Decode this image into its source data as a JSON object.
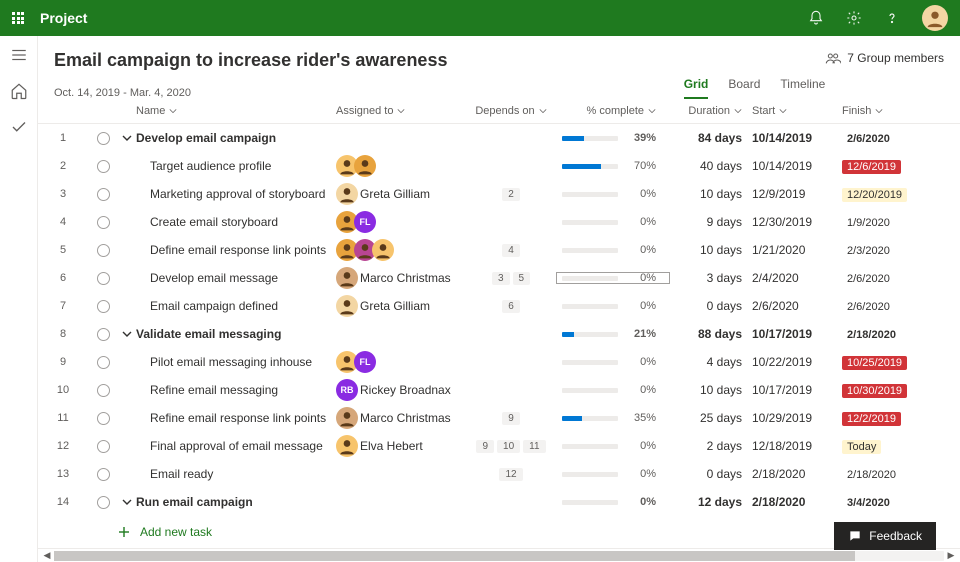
{
  "header": {
    "app_name": "Project",
    "waffle": "app-launcher",
    "bell": "notifications-icon",
    "gear": "settings-icon",
    "help": "help-icon"
  },
  "rail": {
    "hamburger": "menu-icon",
    "home": "home-icon",
    "check": "check-icon"
  },
  "project": {
    "title": "Email campaign to increase rider's awareness",
    "dates": "Oct. 14, 2019 - Mar. 4, 2020",
    "group_members": "7 Group members"
  },
  "tabs": {
    "grid": "Grid",
    "board": "Board",
    "timeline": "Timeline",
    "active": "grid"
  },
  "columns": {
    "name": "Name",
    "assigned": "Assigned to",
    "depends": "Depends on",
    "pct": "% complete",
    "duration": "Duration",
    "start": "Start",
    "finish": "Finish"
  },
  "tasks": [
    {
      "n": 1,
      "summary": true,
      "name": "Develop email campaign",
      "assigned": [],
      "assigned_name": "",
      "deps": [],
      "pct": 39,
      "dur": "84 days",
      "start": "10/14/2019",
      "finish": "2/6/2020",
      "finish_style": ""
    },
    {
      "n": 2,
      "summary": false,
      "name": "Target audience profile",
      "assigned": [
        {
          "bg": "#f7c46c",
          "person": true
        },
        {
          "bg": "#e8a33d",
          "person": true
        }
      ],
      "assigned_name": "",
      "deps": [],
      "pct": 70,
      "dur": "40 days",
      "start": "10/14/2019",
      "finish": "12/6/2019",
      "finish_style": "red"
    },
    {
      "n": 3,
      "summary": false,
      "name": "Marketing approval of storyboard",
      "assigned": [
        {
          "bg": "#f3d6a3",
          "person": true
        }
      ],
      "assigned_name": "Greta Gilliam",
      "deps": [
        "2"
      ],
      "pct": 0,
      "dur": "10 days",
      "start": "12/9/2019",
      "finish": "12/20/2019",
      "finish_style": "yellow"
    },
    {
      "n": 4,
      "summary": false,
      "name": "Create email storyboard",
      "assigned": [
        {
          "bg": "#e8a33d",
          "person": true
        },
        {
          "bg": "#8a2be2",
          "txt": "FL"
        }
      ],
      "assigned_name": "",
      "deps": [],
      "pct": 0,
      "dur": "9 days",
      "start": "12/30/2019",
      "finish": "1/9/2020",
      "finish_style": ""
    },
    {
      "n": 5,
      "summary": false,
      "name": "Define email response link points",
      "assigned": [
        {
          "bg": "#e8a33d",
          "person": true
        },
        {
          "bg": "#b84592",
          "person": true
        },
        {
          "bg": "#f7c46c",
          "person": true
        }
      ],
      "assigned_name": "",
      "deps": [
        "4"
      ],
      "pct": 0,
      "dur": "10 days",
      "start": "1/21/2020",
      "finish": "2/3/2020",
      "finish_style": ""
    },
    {
      "n": 6,
      "summary": false,
      "name": "Develop email message",
      "assigned": [
        {
          "bg": "#d6a77a",
          "person": true
        }
      ],
      "assigned_name": "Marco Christmas",
      "deps": [
        "3",
        "5"
      ],
      "pct": 0,
      "dur": "3 days",
      "start": "2/4/2020",
      "finish": "2/6/2020",
      "finish_style": "",
      "editing": true
    },
    {
      "n": 7,
      "summary": false,
      "name": "Email campaign defined",
      "assigned": [
        {
          "bg": "#f3d6a3",
          "person": true
        }
      ],
      "assigned_name": "Greta Gilliam",
      "deps": [
        "6"
      ],
      "pct": 0,
      "dur": "0 days",
      "start": "2/6/2020",
      "finish": "2/6/2020",
      "finish_style": ""
    },
    {
      "n": 8,
      "summary": true,
      "name": "Validate email messaging",
      "assigned": [],
      "assigned_name": "",
      "deps": [],
      "pct": 21,
      "dur": "88 days",
      "start": "10/17/2019",
      "finish": "2/18/2020",
      "finish_style": ""
    },
    {
      "n": 9,
      "summary": false,
      "name": "Pilot email messaging inhouse",
      "assigned": [
        {
          "bg": "#f7c46c",
          "person": true
        },
        {
          "bg": "#8a2be2",
          "txt": "FL"
        }
      ],
      "assigned_name": "",
      "deps": [],
      "pct": 0,
      "dur": "4 days",
      "start": "10/22/2019",
      "finish": "10/25/2019",
      "finish_style": "red"
    },
    {
      "n": 10,
      "summary": false,
      "name": "Refine email messaging",
      "assigned": [
        {
          "bg": "#8a2be2",
          "txt": "RB"
        }
      ],
      "assigned_name": "Rickey Broadnax",
      "deps": [],
      "pct": 0,
      "dur": "10 days",
      "start": "10/17/2019",
      "finish": "10/30/2019",
      "finish_style": "red"
    },
    {
      "n": 11,
      "summary": false,
      "name": "Refine email response link points",
      "assigned": [
        {
          "bg": "#d6a77a",
          "person": true
        }
      ],
      "assigned_name": "Marco Christmas",
      "deps": [
        "9"
      ],
      "pct": 35,
      "dur": "25 days",
      "start": "10/29/2019",
      "finish": "12/2/2019",
      "finish_style": "red"
    },
    {
      "n": 12,
      "summary": false,
      "name": "Final approval of email message",
      "assigned": [
        {
          "bg": "#f7c46c",
          "person": true
        }
      ],
      "assigned_name": "Elva Hebert",
      "deps": [
        "9",
        "10",
        "11"
      ],
      "pct": 0,
      "dur": "2 days",
      "start": "12/18/2019",
      "finish": "Today",
      "finish_style": "yellow"
    },
    {
      "n": 13,
      "summary": false,
      "name": "Email ready",
      "assigned": [],
      "assigned_name": "",
      "deps": [
        "12"
      ],
      "pct": 0,
      "dur": "0 days",
      "start": "2/18/2020",
      "finish": "2/18/2020",
      "finish_style": ""
    },
    {
      "n": 14,
      "summary": true,
      "name": "Run email campaign",
      "assigned": [],
      "assigned_name": "",
      "deps": [],
      "pct": 0,
      "dur": "12 days",
      "start": "2/18/2020",
      "finish": "3/4/2020",
      "finish_style": ""
    }
  ],
  "add_task": "Add new task",
  "feedback": "Feedback"
}
